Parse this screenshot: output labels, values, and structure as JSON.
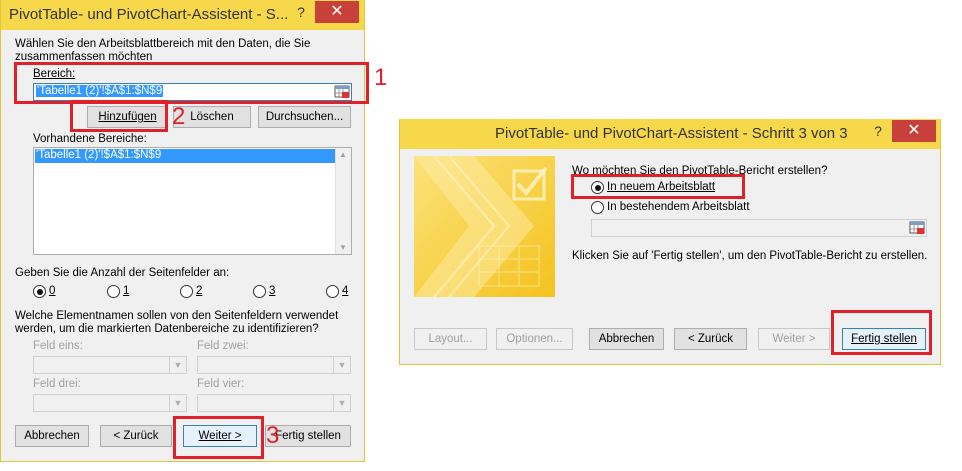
{
  "dialog1": {
    "title": "PivotTable- und PivotChart-Assistent - S...",
    "help_glyph": "?",
    "close_glyph": "✕",
    "instruction_line1": "Wählen Sie den Arbeitsblattbereich mit den Daten, die Sie",
    "instruction_line2": "zusammenfassen möchten",
    "range_label": "Bereich:",
    "range_value": "'Tabelle1 (2)'!$A$1:$N$9",
    "add_button": "Hinzufügen",
    "delete_button": "Löschen",
    "browse_button": "Durchsuchen...",
    "existing_ranges_label": "Vorhandene Bereiche:",
    "existing_ranges": [
      "'Tabelle1 (2)'!$A$1:$N$9"
    ],
    "page_fields_label": "Geben Sie die Anzahl der Seitenfelder an:",
    "page_field_options": [
      "0",
      "1",
      "2",
      "3",
      "4"
    ],
    "selected_page_field_option": "0",
    "item_names_line1": "Welche Elementnamen sollen von den Seitenfeldern verwendet",
    "item_names_line2": "werden, um die markierten Datenbereiche zu identifizieren?",
    "field_one": "Feld eins:",
    "field_two": "Feld zwei:",
    "field_three": "Feld drei:",
    "field_four": "Feld vier:",
    "cancel_button": "Abbrechen",
    "back_button": "< Zurück",
    "next_button": "Weiter >",
    "finish_button": "Fertig stellen"
  },
  "dialog2": {
    "title": "PivotTable- und PivotChart-Assistent - Schritt 3 von 3",
    "help_glyph": "?",
    "close_glyph": "✕",
    "question": "Wo möchten Sie den PivotTable-Bericht erstellen?",
    "option_new_sheet": "In neuem Arbeitsblatt",
    "option_existing_sheet": "In bestehendem Arbeitsblatt",
    "selected_option": "In neuem Arbeitsblatt",
    "hint": "Klicken Sie auf 'Fertig stellen', um den PivotTable-Bericht zu erstellen.",
    "layout_button": "Layout...",
    "options_button": "Optionen...",
    "cancel_button": "Abbrechen",
    "back_button": "< Zurück",
    "next_button": "Weiter >",
    "finish_button": "Fertig stellen"
  },
  "annotations": [
    "1",
    "2",
    "3"
  ],
  "colors": {
    "title_bar": "#f6d84a",
    "close_button": "#c7413a",
    "annotation_red": "#e0202a",
    "selection_blue": "#3399ff",
    "dialog_face": "#f0f0f0"
  }
}
